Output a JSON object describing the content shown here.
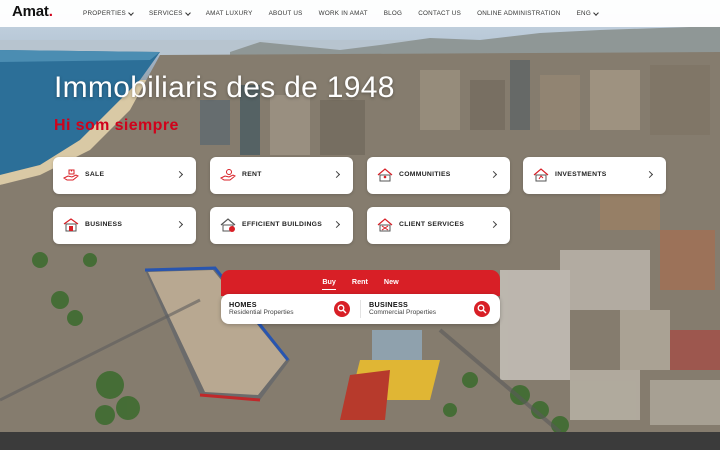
{
  "brand": {
    "logo_text": "Amat",
    "logo_dot": "."
  },
  "nav": {
    "items": [
      {
        "label": "PROPERTIES",
        "dropdown": true
      },
      {
        "label": "SERVICES",
        "dropdown": true
      },
      {
        "label": "AMAT LUXURY",
        "dropdown": false
      },
      {
        "label": "ABOUT US",
        "dropdown": false
      },
      {
        "label": "WORK IN AMAT",
        "dropdown": false
      },
      {
        "label": "BLOG",
        "dropdown": false
      },
      {
        "label": "CONTACT US",
        "dropdown": false
      },
      {
        "label": "ONLINE ADMINISTRATION",
        "dropdown": false
      }
    ],
    "language": "ENG"
  },
  "hero": {
    "title": "Immobiliaris des de 1948",
    "subtitle": "Hi som siempre"
  },
  "cards": [
    {
      "label": "SALE",
      "icon": "sale-hand-icon"
    },
    {
      "label": "RENT",
      "icon": "rent-hand-icon"
    },
    {
      "label": "COMMUNITIES",
      "icon": "communities-house-icon"
    },
    {
      "label": "INVESTMENTS",
      "icon": "investments-house-icon"
    },
    {
      "label": "BUSINESS",
      "icon": "business-storefront-icon"
    },
    {
      "label": "EFFICIENT BUILDINGS",
      "icon": "efficient-house-icon"
    },
    {
      "label": "CLIENT SERVICES",
      "icon": "client-services-house-icon"
    }
  ],
  "search": {
    "tabs": [
      "Buy",
      "Rent",
      "New"
    ],
    "active_tab": "Buy",
    "options": [
      {
        "title": "HOMES",
        "subtitle": "Residential Properties"
      },
      {
        "title": "BUSINESS",
        "subtitle": "Commercial Properties"
      }
    ]
  },
  "colors": {
    "accent": "#d81f26",
    "brand_red": "#d0021b"
  }
}
